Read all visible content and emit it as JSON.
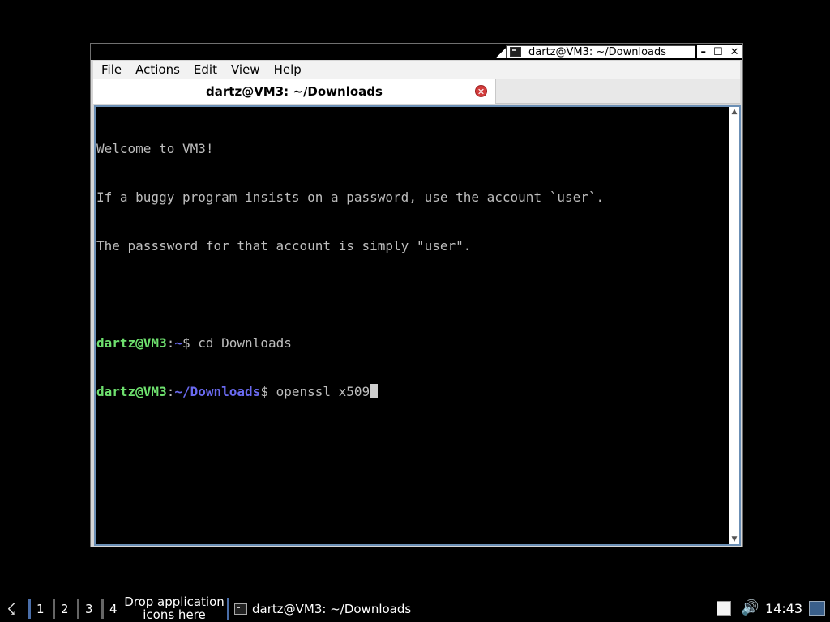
{
  "window": {
    "title": "dartz@VM3: ~/Downloads",
    "controls": {
      "minimize": "–",
      "maximize": "☐",
      "close": "✕"
    }
  },
  "menubar": {
    "items": [
      "File",
      "Actions",
      "Edit",
      "View",
      "Help"
    ]
  },
  "tabs": [
    {
      "label": "dartz@VM3: ~/Downloads",
      "close": "✕"
    }
  ],
  "terminal": {
    "lines": [
      "Welcome to VM3!",
      "If a buggy program insists on a password, use the account `user`.",
      "The passsword for that account is simply \"user\".",
      ""
    ],
    "prompts": [
      {
        "user": "dartz@VM3",
        "colon": ":",
        "path": "~",
        "dollar": "$ ",
        "command": "cd Downloads"
      },
      {
        "user": "dartz@VM3",
        "colon": ":",
        "path": "~/Downloads",
        "dollar": "$ ",
        "command": "openssl x509"
      }
    ],
    "scroll_up": "▲",
    "scroll_down": "▼"
  },
  "taskbar": {
    "start_icon": "start-menu-icon",
    "workspaces": [
      "1",
      "2",
      "3",
      "4"
    ],
    "drop_hint": "Drop application icons here",
    "task_title": "dartz@VM3: ~/Downloads",
    "clock": "14:43",
    "volume_icon": "🔊"
  }
}
